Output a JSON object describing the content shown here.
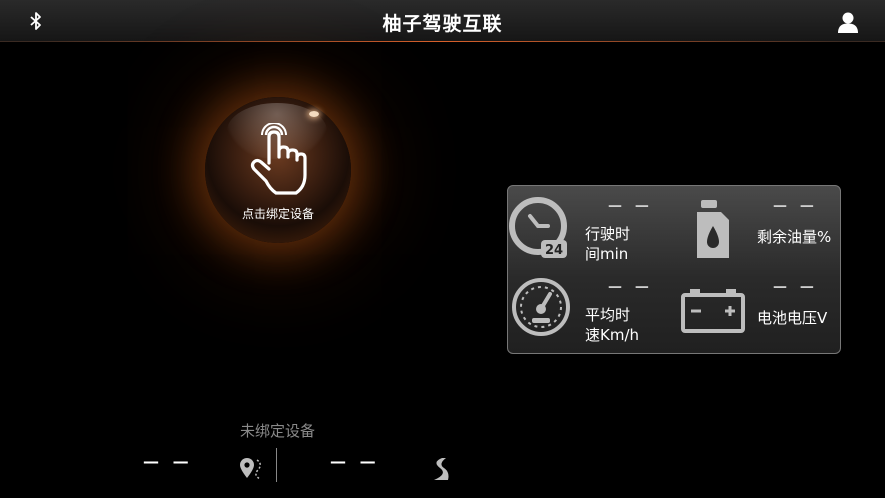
{
  "header": {
    "title": "柚子驾驶互联",
    "left_icon": "bluetooth-icon",
    "right_icon": "user-icon"
  },
  "bind_button": {
    "label": "点击绑定设备",
    "icon": "touch-hand-icon"
  },
  "stats": {
    "drive_time": {
      "value": "— —",
      "label_line1": "行驶时",
      "label_line2": "间min",
      "icon": "clock-24h-icon"
    },
    "fuel": {
      "value": "— —",
      "label": "剩余油量%",
      "icon": "fuel-can-icon"
    },
    "avg_speed": {
      "value": "— —",
      "label_line1": "平均时",
      "label_line2": "速Km/h",
      "icon": "speedometer-icon"
    },
    "battery": {
      "value": "— —",
      "label": "电池电压V",
      "icon": "battery-icon"
    }
  },
  "bottom": {
    "status": "未绑定设备",
    "left_value": "— —",
    "right_value": "— —",
    "location_icon": "location-pin-icon",
    "route_icon": "road-icon"
  },
  "colors": {
    "accent": "#e07a2a",
    "background": "#000000",
    "panel": "#3a3a3a",
    "muted_text": "#8a8a8a"
  }
}
